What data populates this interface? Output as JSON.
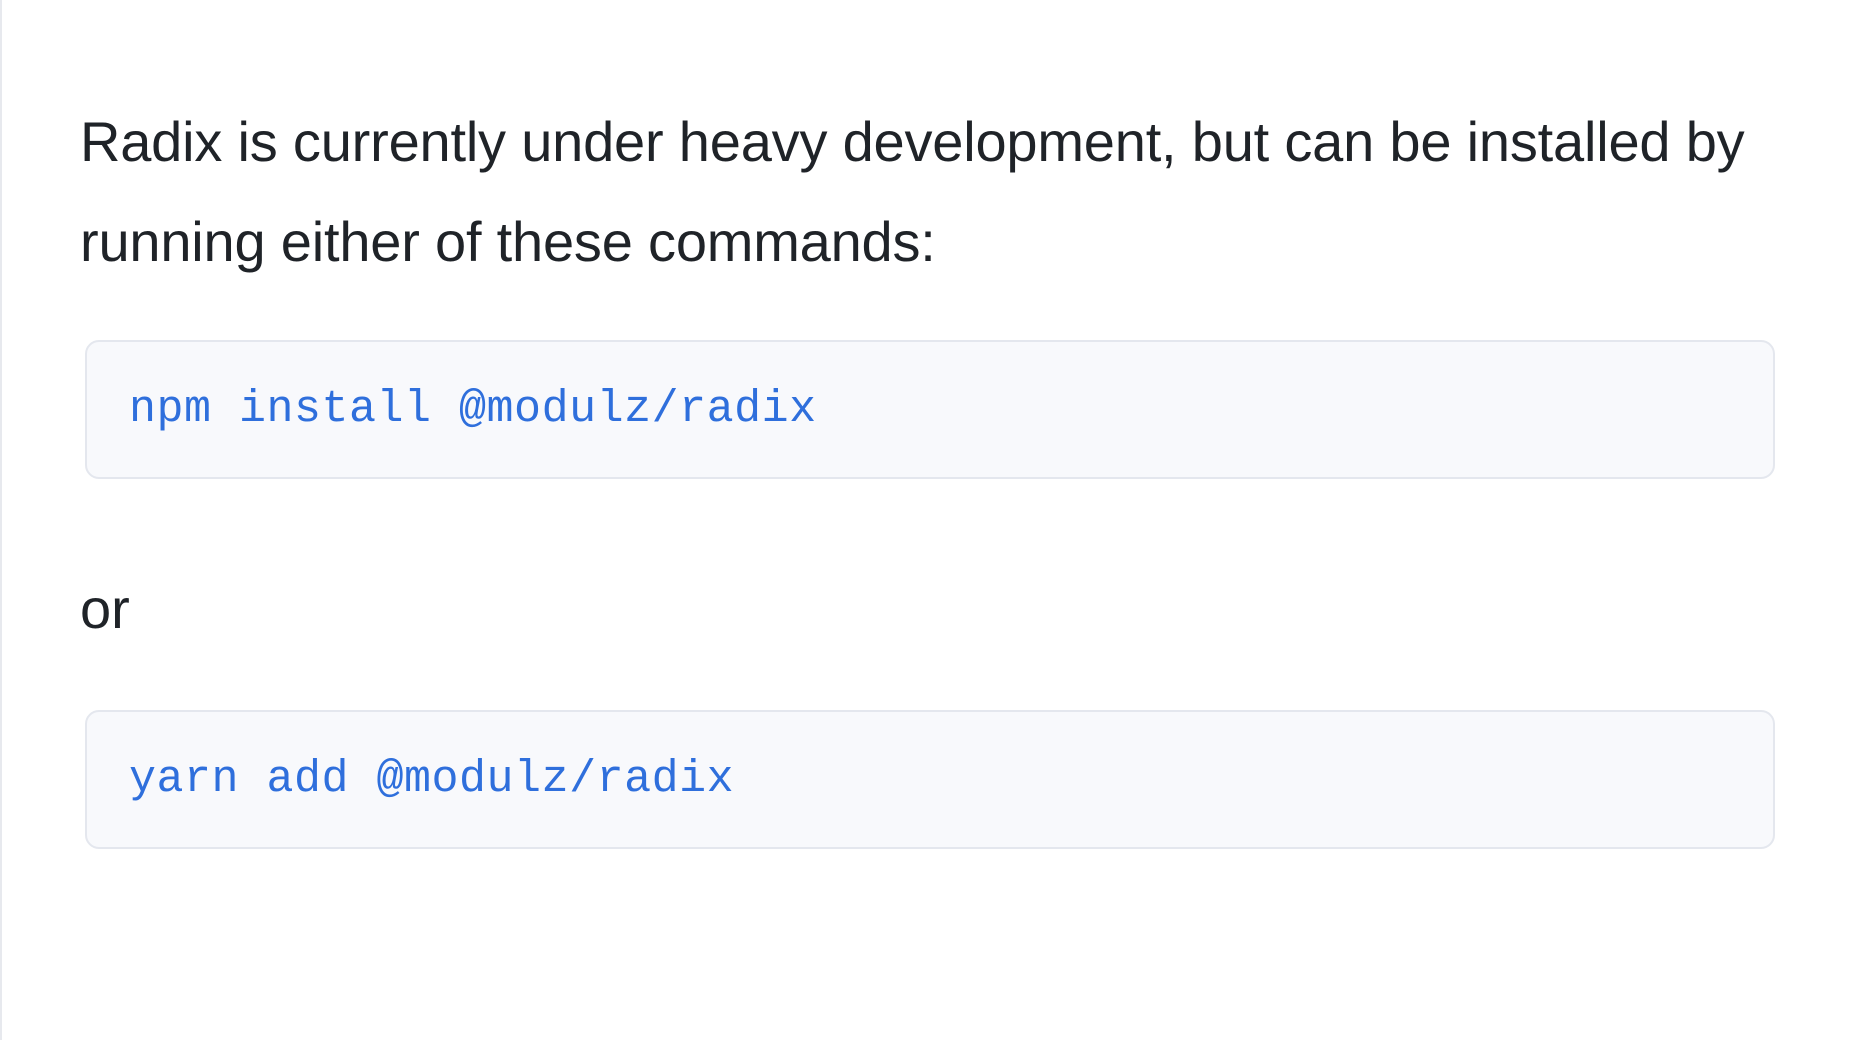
{
  "intro": {
    "text": "Radix is currently under heavy development, but can be installed by running either of these commands:"
  },
  "commands": [
    {
      "code": "npm install @modulz/radix"
    },
    {
      "code": "yarn add @modulz/radix"
    }
  ],
  "separator": {
    "text": "or"
  },
  "colors": {
    "text": "#1f2328",
    "code": "#2f6fdc",
    "code_background": "#f8f9fc",
    "code_border": "#e4e7ee"
  }
}
